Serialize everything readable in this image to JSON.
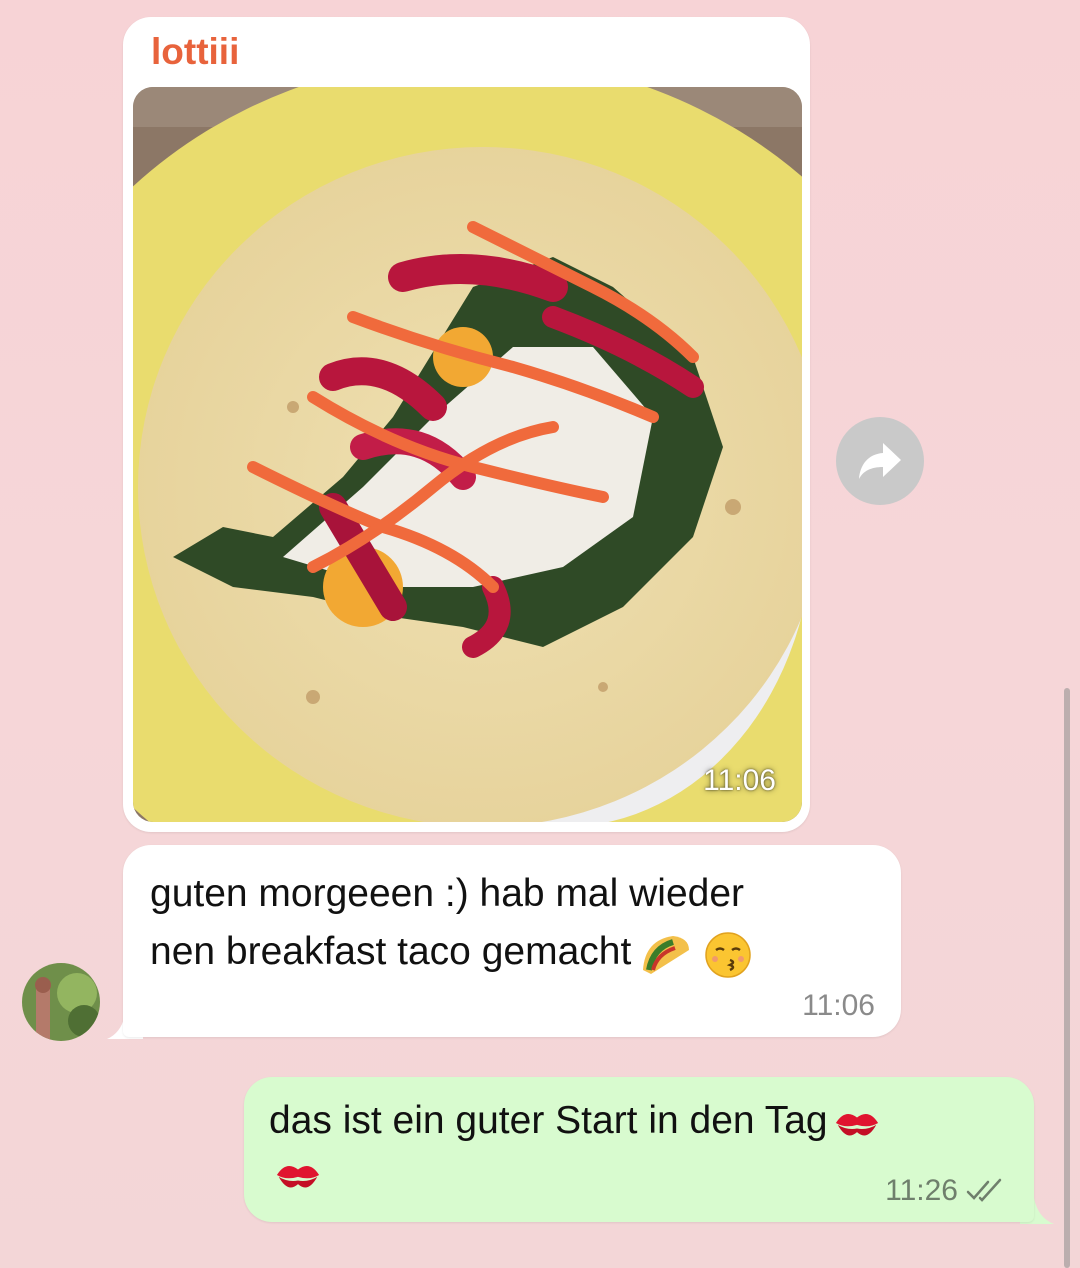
{
  "image_message": {
    "sender": "lottiii",
    "time": "11:06"
  },
  "text_message_in": {
    "line1": "guten morgeeen :) hab mal wieder",
    "line2": "nen breakfast taco gemacht",
    "time": "11:06"
  },
  "text_message_out": {
    "text": "das ist ein guter Start in den Tag",
    "time": "11:26",
    "status": "read"
  },
  "colors": {
    "sender_name": "#e8633c",
    "incoming_bubble": "#ffffff",
    "outgoing_bubble": "#d8fbcf",
    "background": "#f7d3d6"
  },
  "icons": {
    "forward": "forward-arrow-icon",
    "taco": "taco-emoji",
    "kiss_face": "kissing-face-emoji",
    "kiss_mark": "kiss-mark-emoji",
    "read_receipt": "double-check-icon"
  }
}
